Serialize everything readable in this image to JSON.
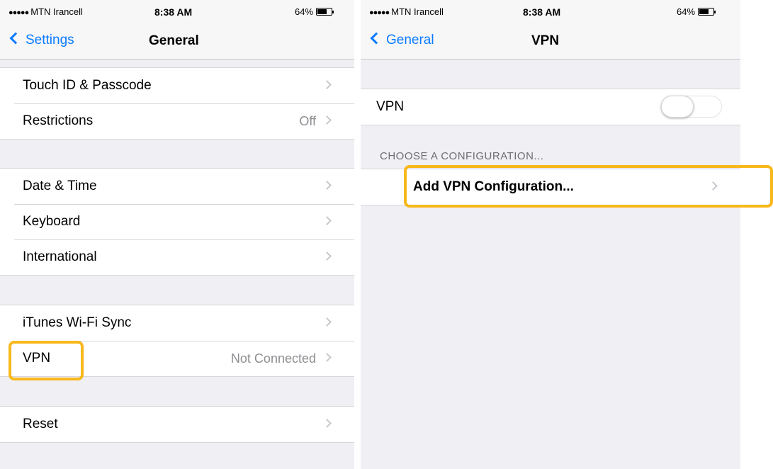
{
  "left": {
    "status": {
      "carrier_dots": "●●●●●",
      "carrier": "MTN Irancell",
      "time": "8:38 AM",
      "battery": "64%",
      "battery_level": 0.64
    },
    "nav": {
      "back_label": "Settings",
      "title": "General"
    },
    "groups": [
      [
        {
          "label": "Touch ID & Passcode",
          "value": ""
        },
        {
          "label": "Restrictions",
          "value": "Off"
        }
      ],
      [
        {
          "label": "Date & Time",
          "value": ""
        },
        {
          "label": "Keyboard",
          "value": ""
        },
        {
          "label": "International",
          "value": ""
        }
      ],
      [
        {
          "label": "iTunes Wi-Fi Sync",
          "value": ""
        },
        {
          "label": "VPN",
          "value": "Not Connected"
        }
      ],
      [
        {
          "label": "Reset",
          "value": ""
        }
      ]
    ]
  },
  "right": {
    "status": {
      "carrier_dots": "●●●●●",
      "carrier": "MTN Irancell",
      "time": "8:38 AM",
      "battery": "64%",
      "battery_level": 0.64
    },
    "nav": {
      "back_label": "General",
      "title": "VPN"
    },
    "vpn_row": {
      "label": "VPN",
      "toggle_on": false
    },
    "section_header": "CHOOSE A CONFIGURATION...",
    "add_row": {
      "label": "Add VPN Configuration..."
    }
  },
  "highlight_color": "#f8b81b",
  "accent_color": "#0a7bff"
}
